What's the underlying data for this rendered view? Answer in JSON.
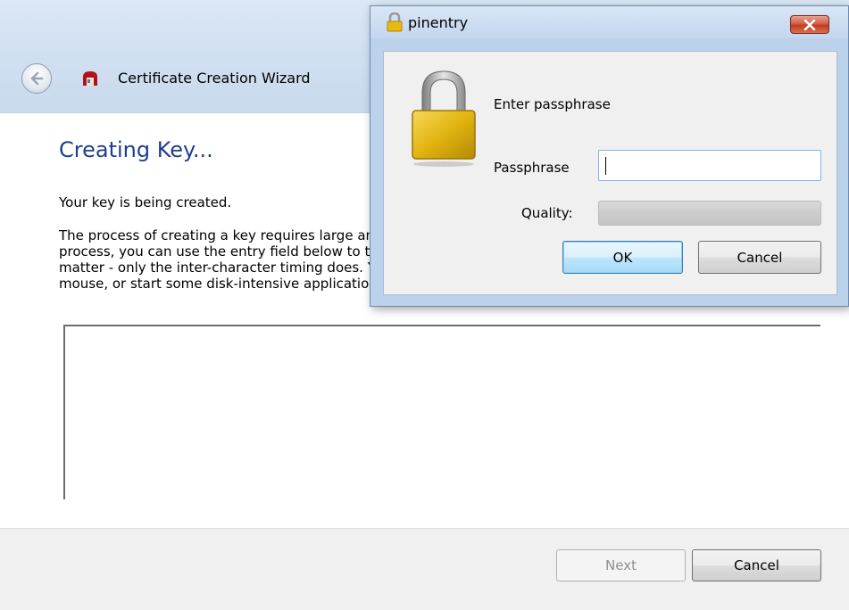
{
  "wizard": {
    "title": "Certificate Creation Wizard",
    "heading": "Creating Key...",
    "status_text": "Your key is being created.",
    "description_lines": [
      "The process of creating a key requires large amounts of random numbers. To foster this",
      "process, you can use the entry field below to type some arbitrary data. The data itself does not",
      "matter - only the inter-character timing does. You can also move the selected text with your",
      "mouse, or start some disk-intensive application."
    ],
    "entry_value": "",
    "buttons": {
      "next": "Next",
      "cancel": "Cancel"
    },
    "icons": {
      "back": "back-arrow-icon",
      "app": "kleopatra-app-icon"
    }
  },
  "pinentry": {
    "title": "pinentry",
    "description": "Enter passphrase",
    "passphrase_label": "Passphrase",
    "passphrase_value": "",
    "quality_label": "Quality:",
    "quality_fraction": 0,
    "buttons": {
      "ok": "OK",
      "cancel": "Cancel"
    },
    "icons": {
      "title": "lock-icon",
      "main": "padlock-icon",
      "close": "close-icon"
    }
  },
  "colors": {
    "heading": "#1e3f8f",
    "quality_fill": "#06b025",
    "close_button": "#c23b22"
  }
}
